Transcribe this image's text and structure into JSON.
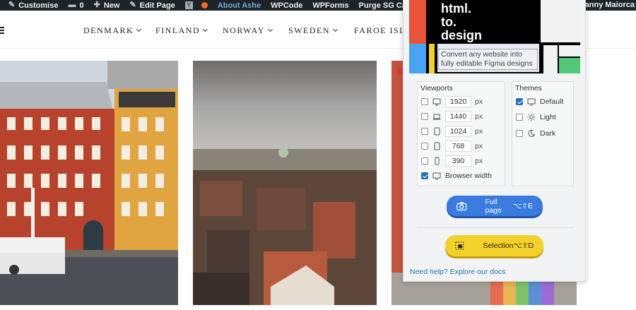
{
  "adminbar": {
    "items": [
      {
        "icon": "gear-icon",
        "label": "Customise"
      },
      {
        "icon": "comment-icon",
        "label": "0"
      },
      {
        "icon": "plus-icon",
        "label": "New"
      },
      {
        "icon": "pencil-icon",
        "label": "Edit Page"
      },
      {
        "icon": "yoast-icon",
        "label": ""
      },
      {
        "icon": "status-dot-icon",
        "label": ""
      },
      {
        "icon": "",
        "label": "About Ashe"
      },
      {
        "icon": "",
        "label": "WPCode"
      },
      {
        "icon": "",
        "label": "WPForms"
      },
      {
        "icon": "",
        "label": "Purge SG Cache"
      }
    ],
    "user": "Danny Maiorca",
    "active_color": "#72aee6"
  },
  "nav": {
    "items": [
      "DENMARK",
      "FINLAND",
      "NORWAY",
      "SWEDEN",
      "FAROE ISLA"
    ]
  },
  "photos": [
    {
      "subject": "colorful-townhouses-photo"
    },
    {
      "subject": "city-rooftops-photo"
    },
    {
      "subject": "rainbow-street-photo"
    }
  ],
  "plugin": {
    "banner_title": [
      "html.",
      "to.",
      "design"
    ],
    "banner_sub": "Convert any website into fully editable Figma designs",
    "viewports_label": "Viewports",
    "themes_label": "Themes",
    "viewports": [
      {
        "device": "desktop-icon",
        "value": "1920",
        "unit": "px",
        "checked": false
      },
      {
        "device": "laptop-icon",
        "value": "1440",
        "unit": "px",
        "checked": false
      },
      {
        "device": "tablet-icon",
        "value": "1024",
        "unit": "px",
        "checked": false
      },
      {
        "device": "tablet-icon",
        "value": "768",
        "unit": "px",
        "checked": false
      },
      {
        "device": "phone-icon",
        "value": "390",
        "unit": "px",
        "checked": false
      }
    ],
    "browser_width": {
      "label": "Browser width",
      "checked": true
    },
    "themes": [
      {
        "icon": "monitor-icon",
        "label": "Default",
        "checked": true
      },
      {
        "icon": "sun-icon",
        "label": "Light",
        "checked": false
      },
      {
        "icon": "moon-icon",
        "label": "Dark",
        "checked": false
      }
    ],
    "full_page": {
      "label": "Full page",
      "shortcut": "⌥⇧E",
      "color": "#3a7be0"
    },
    "selection": {
      "label": "Selection",
      "shortcut": "⌥⇧D",
      "color": "#f4d12a"
    },
    "help": "Need help? Explore our docs"
  }
}
